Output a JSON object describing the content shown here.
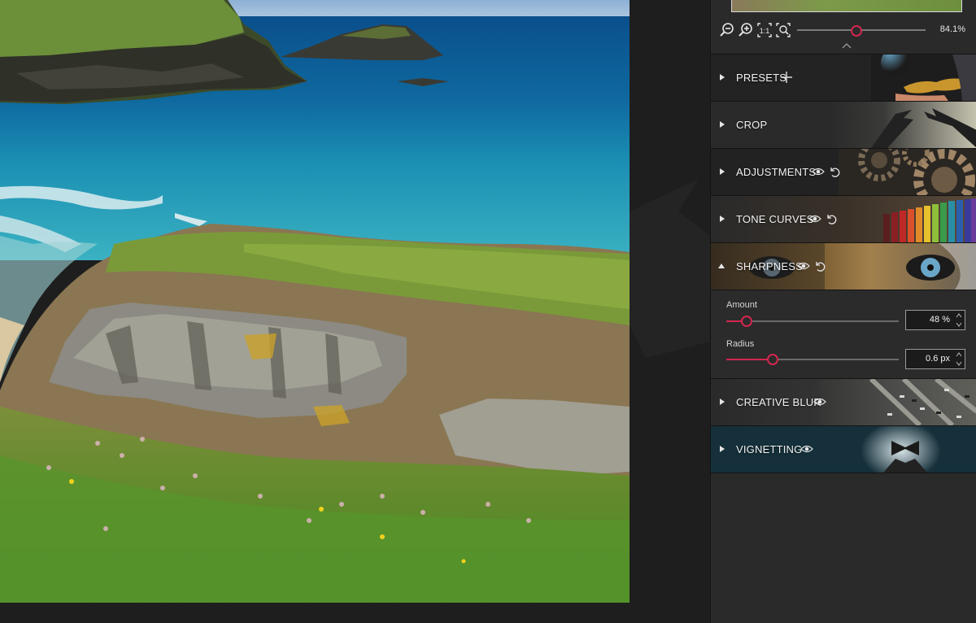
{
  "navigator": {
    "zoom_value": "84.1%",
    "zoom_level_percent": 84.1,
    "zoom_out_icon": "zoom-out-icon",
    "zoom_in_icon": "zoom-in-icon",
    "actual_size_icon": "one-to-one-icon",
    "fit_icon": "fit-screen-icon"
  },
  "sections": [
    {
      "id": "presets",
      "label": "PRESETS",
      "icons": [
        "plus-icon"
      ],
      "expanded": false
    },
    {
      "id": "crop",
      "label": "CROP",
      "icons": [],
      "expanded": false
    },
    {
      "id": "adjustments",
      "label": "ADJUSTMENTS",
      "icons": [
        "eye-icon",
        "undo-icon"
      ],
      "expanded": false
    },
    {
      "id": "tone-curves",
      "label": "TONE CURVES",
      "icons": [
        "eye-icon",
        "undo-icon"
      ],
      "expanded": false
    },
    {
      "id": "sharpness",
      "label": "SHARPNESS",
      "icons": [
        "eye-icon",
        "undo-icon"
      ],
      "expanded": true
    },
    {
      "id": "creative-blur",
      "label": "CREATIVE BLUR",
      "icons": [
        "eye-icon"
      ],
      "expanded": false
    },
    {
      "id": "vignetting",
      "label": "VIGNETTING",
      "icons": [
        "eye-icon"
      ],
      "expanded": false
    }
  ],
  "sharpness": {
    "amount": {
      "label": "Amount",
      "value": "48 %",
      "fraction": 0.12
    },
    "radius": {
      "label": "Radius",
      "value": "0.6 px",
      "fraction": 0.27
    }
  },
  "colors": {
    "accent": "#d3264f",
    "panel_bg": "#2a2a2a",
    "canvas_bg": "#1e1e1e"
  }
}
